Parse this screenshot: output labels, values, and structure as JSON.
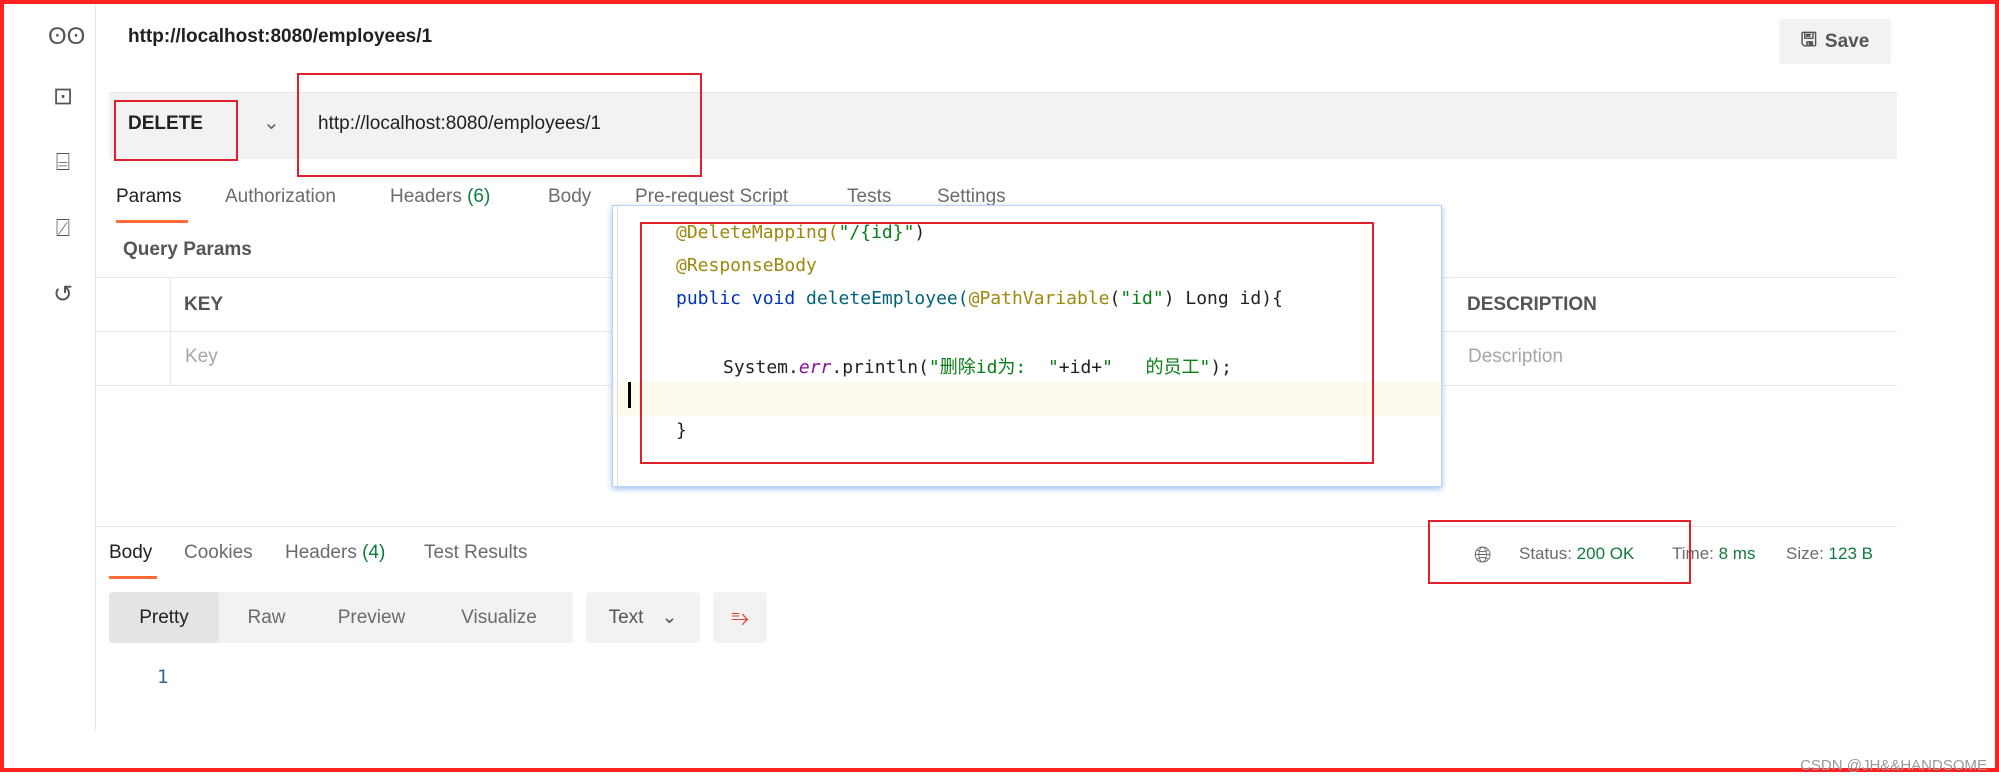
{
  "title": "http://localhost:8080/employees/1",
  "save_label": "Save",
  "request": {
    "method": "DELETE",
    "url": "http://localhost:8080/employees/1"
  },
  "tabs": [
    {
      "label": "Params"
    },
    {
      "label": "Authorization"
    },
    {
      "label": "Headers",
      "count": "(6)"
    },
    {
      "label": "Body"
    },
    {
      "label": "Pre-request Script"
    },
    {
      "label": "Tests"
    },
    {
      "label": "Settings"
    }
  ],
  "query_params": {
    "title": "Query Params",
    "columns": [
      "KEY",
      "DESCRIPTION"
    ],
    "placeholders": [
      "Key",
      "Description"
    ]
  },
  "code": {
    "line1a": "@DeleteMapping(",
    "line1b": "\"/{id}\"",
    "line1c": ")",
    "line2": "@ResponseBody",
    "line3a": "public void ",
    "line3b": "deleteEmployee(",
    "line3c": "@PathVariable",
    "line3d": "(",
    "line3e": "\"id\"",
    "line3f": ") Long id){",
    "line4a": "System.",
    "line4b": "err",
    "line4c": ".println(",
    "line4d": "\"删除id为:  \"",
    "line4e": "+id+",
    "line4f": "\"   的员工\"",
    "line4g": ");",
    "line6": "}"
  },
  "response": {
    "tabs": [
      {
        "label": "Body"
      },
      {
        "label": "Cookies"
      },
      {
        "label": "Headers",
        "count": "(4)"
      },
      {
        "label": "Test Results"
      }
    ],
    "status_label": "Status:",
    "status": "200 OK",
    "time_label": "Time:",
    "time": "8 ms",
    "size_label": "Size:",
    "size": "123 B",
    "views": [
      "Pretty",
      "Raw",
      "Preview",
      "Visualize"
    ],
    "format": "Text",
    "line_number": "1"
  },
  "watermark": "CSDN @JH&&HANDSOME",
  "colors": {
    "accent": "#ff6c37",
    "status_green": "#0f7b3c",
    "highlight_red": "#e0202a"
  }
}
